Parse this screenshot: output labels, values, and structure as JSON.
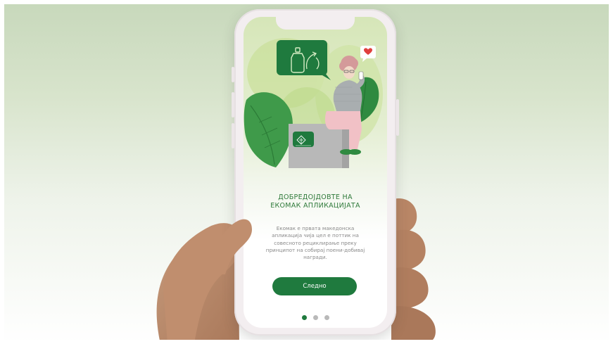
{
  "onboarding": {
    "title_line1": "ДОБРЕДОЈДОВТЕ НА",
    "title_line2": "ЕКОМАК АПЛИКАЦИЈАТА",
    "description_lines": [
      "Екомак е првата македонска",
      "апликација чија цел е поттик на",
      "совесното рециклирање преку",
      "принципот на собирај поени-добивај",
      "награди."
    ],
    "next_label": "Следно",
    "pagination": {
      "total": 3,
      "active_index": 0
    }
  },
  "colors": {
    "brand_green": "#1f7a3e",
    "title_green": "#2f7a3a",
    "description_gray": "#8a8a8a",
    "inactive_dot": "#b9b9b9",
    "heart_red": "#e0403d"
  },
  "icons": {
    "bottle": "recycle-bottle-icon",
    "heart": "heart-icon",
    "app_logo": "ekomak-logo-icon"
  }
}
